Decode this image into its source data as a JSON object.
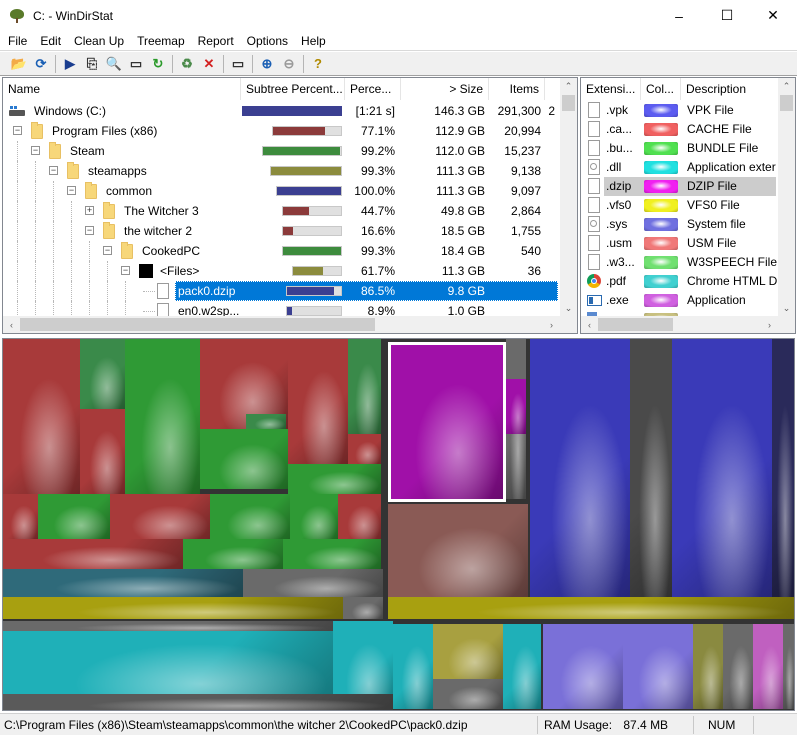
{
  "window": {
    "title": "C: - WinDirStat",
    "controls": {
      "minimize": "–",
      "maximize": "☐",
      "close": "✕"
    }
  },
  "menubar": {
    "items": [
      {
        "label": "File",
        "accel": "F"
      },
      {
        "label": "Edit",
        "accel": "E"
      },
      {
        "label": "Clean Up",
        "accel": "C"
      },
      {
        "label": "Treemap",
        "accel": "T"
      },
      {
        "label": "Report",
        "accel": "R"
      },
      {
        "label": "Options",
        "accel": "O"
      },
      {
        "label": "Help",
        "accel": "H"
      }
    ]
  },
  "toolbar": {
    "buttons": [
      {
        "name": "open-icon",
        "glyph": "📂"
      },
      {
        "name": "rescan-icon",
        "glyph": "⟳"
      },
      {
        "name": "play-icon",
        "glyph": "▶"
      },
      {
        "name": "copy-path-icon",
        "glyph": "⎘"
      },
      {
        "name": "explorer-icon",
        "glyph": "🔍"
      },
      {
        "name": "cmd-prompt-icon",
        "glyph": "▭"
      },
      {
        "name": "refresh-icon",
        "glyph": "↻"
      },
      {
        "name": "recycle-bin-icon",
        "glyph": "♻"
      },
      {
        "name": "delete-icon",
        "glyph": "✕"
      },
      {
        "name": "properties-icon",
        "glyph": "▭"
      },
      {
        "name": "zoom-in-icon",
        "glyph": "⊕"
      },
      {
        "name": "zoom-out-icon",
        "glyph": "⊖"
      },
      {
        "name": "help-icon",
        "glyph": "?"
      }
    ]
  },
  "tree": {
    "columns": [
      "Name",
      "Subtree Percent...",
      "Perce...",
      "> Size",
      "Items"
    ],
    "rows": [
      {
        "name": "Windows (C:)",
        "level": 0,
        "icon": "drive",
        "expander": "",
        "subtree_pct": 1.0,
        "bar_color": "#3b3f91",
        "percent": "[1:21 s]",
        "size": "146.3 GB",
        "items": "291,300",
        "extra": "2"
      },
      {
        "name": "Program Files (x86)",
        "level": 1,
        "icon": "folder",
        "expander": "−",
        "subtree_pct": 0.771,
        "bar_color": "#8b3a3a",
        "percent": "77.1%",
        "size": "112.9 GB",
        "items": "20,994",
        "extra": ""
      },
      {
        "name": "Steam",
        "level": 2,
        "icon": "folder",
        "expander": "−",
        "subtree_pct": 0.992,
        "bar_color": "#3d8b3d",
        "percent": "99.2%",
        "size": "112.0 GB",
        "items": "15,237",
        "extra": ""
      },
      {
        "name": "steamapps",
        "level": 3,
        "icon": "folder",
        "expander": "−",
        "subtree_pct": 0.993,
        "bar_color": "#8b8b3d",
        "percent": "99.3%",
        "size": "111.3 GB",
        "items": "9,138",
        "extra": ""
      },
      {
        "name": "common",
        "level": 4,
        "icon": "folder",
        "expander": "−",
        "subtree_pct": 1.0,
        "bar_color": "#3b3f91",
        "percent": "100.0%",
        "size": "111.3 GB",
        "items": "9,097",
        "extra": ""
      },
      {
        "name": "The Witcher 3",
        "level": 5,
        "icon": "folder",
        "expander": "+",
        "subtree_pct": 0.447,
        "bar_color": "#8b3a3a",
        "percent": "44.7%",
        "size": "49.8 GB",
        "items": "2,864",
        "extra": ""
      },
      {
        "name": "the witcher 2",
        "level": 5,
        "icon": "folder",
        "expander": "−",
        "subtree_pct": 0.166,
        "bar_color": "#8b3a3a",
        "percent": "16.6%",
        "size": "18.5 GB",
        "items": "1,755",
        "extra": ""
      },
      {
        "name": "CookedPC",
        "level": 6,
        "icon": "folder",
        "expander": "−",
        "subtree_pct": 0.993,
        "bar_color": "#3d8b3d",
        "percent": "99.3%",
        "size": "18.4 GB",
        "items": "540",
        "extra": ""
      },
      {
        "name": "<Files>",
        "level": 7,
        "icon": "files",
        "expander": "−",
        "subtree_pct": 0.617,
        "bar_color": "#8b8b3d",
        "percent": "61.7%",
        "size": "11.3 GB",
        "items": "36",
        "extra": ""
      },
      {
        "name": "pack0.dzip",
        "level": 8,
        "icon": "file",
        "expander": "",
        "subtree_pct": 0.865,
        "bar_color": "#3b3f91",
        "percent": "86.5%",
        "size": "9.8 GB",
        "items": "",
        "extra": "",
        "selected": true
      },
      {
        "name": "en0.w2sp...",
        "level": 8,
        "icon": "file",
        "expander": "",
        "subtree_pct": 0.089,
        "bar_color": "#3b3f91",
        "percent": "8.9%",
        "size": "1.0 GB",
        "items": "",
        "extra": ""
      }
    ]
  },
  "extensions": {
    "columns": [
      "Extensi...",
      "Col...",
      "Description"
    ],
    "rows": [
      {
        "ext": ".vpk",
        "color": "#5c5cf0",
        "description": "VPK File",
        "icon": "file"
      },
      {
        "ext": ".ca...",
        "color": "#f06060",
        "description": "CACHE File",
        "icon": "file"
      },
      {
        "ext": ".bu...",
        "color": "#50e050",
        "description": "BUNDLE File",
        "icon": "file"
      },
      {
        "ext": ".dll",
        "color": "#20e0e0",
        "description": "Application exter",
        "icon": "gear-file"
      },
      {
        "ext": ".dzip",
        "color": "#f020f0",
        "description": "DZIP File",
        "icon": "file",
        "selected": true
      },
      {
        "ext": ".vfs0",
        "color": "#f0f020",
        "description": "VFS0 File",
        "icon": "file"
      },
      {
        "ext": ".sys",
        "color": "#7070e0",
        "description": "System file",
        "icon": "gear-file"
      },
      {
        "ext": ".usm",
        "color": "#f07878",
        "description": "USM File",
        "icon": "file"
      },
      {
        "ext": ".w3...",
        "color": "#70e070",
        "description": "W3SPEECH File",
        "icon": "file"
      },
      {
        "ext": ".pdf",
        "color": "#40d0d0",
        "description": "Chrome HTML D",
        "icon": "chrome"
      },
      {
        "ext": ".exe",
        "color": "#d060e0",
        "description": "Application",
        "icon": "app"
      },
      {
        "ext": "",
        "color": "#c8c080",
        "description": "",
        "icon": "partial"
      }
    ]
  },
  "statusbar": {
    "path": "C:\\Program Files (x86)\\Steam\\steamapps\\common\\the witcher 2\\CookedPC\\pack0.dzip",
    "ram_label": "RAM Usage:",
    "ram_value": "87.4 MB",
    "num": "NUM"
  }
}
